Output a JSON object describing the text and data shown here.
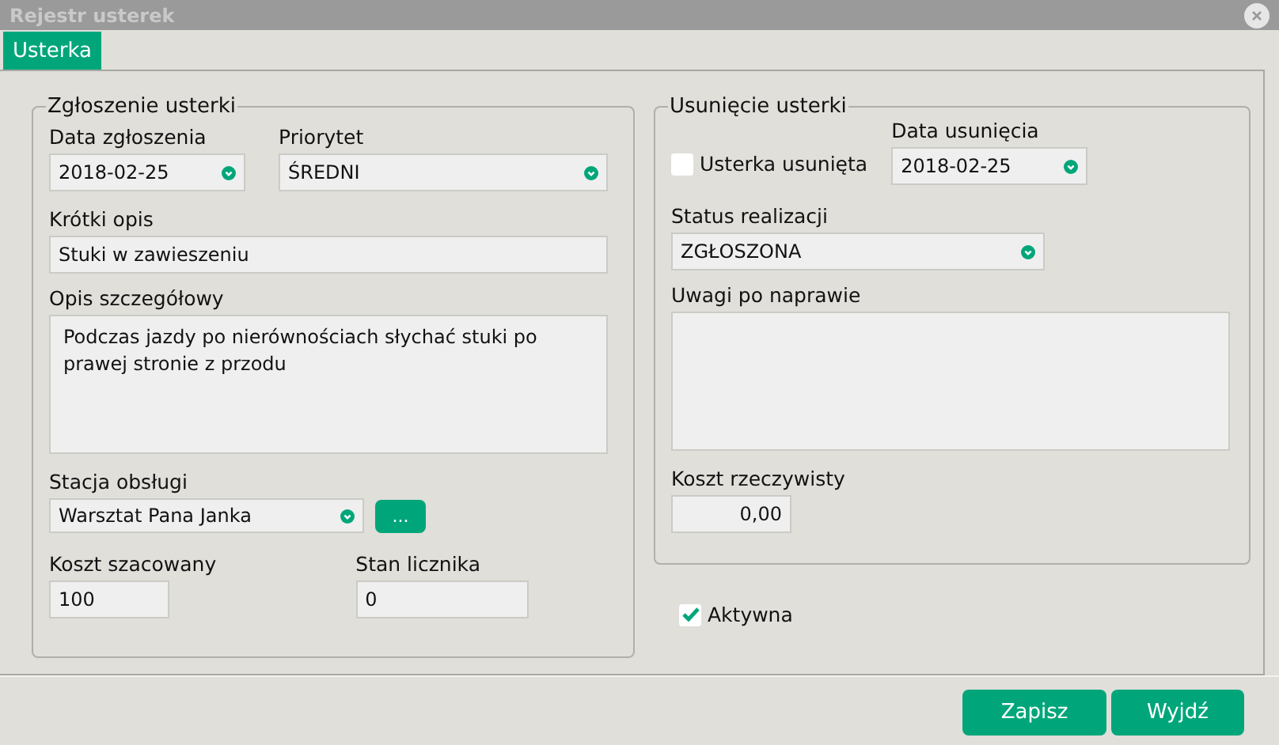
{
  "window": {
    "title": "Rejestr usterek"
  },
  "tabs": [
    {
      "label": "Usterka",
      "selected": true
    }
  ],
  "report": {
    "legend": "Zgłoszenie usterki",
    "date": {
      "label": "Data zgłoszenia",
      "value": "2018-02-25"
    },
    "priority": {
      "label": "Priorytet",
      "value": "ŚREDNI"
    },
    "short_description": {
      "label": "Krótki opis",
      "value": "Stuki w zawieszeniu"
    },
    "details": {
      "label": "Opis szczegółowy",
      "value": "Podczas jazdy po nierównościach słychać stuki po prawej stronie z przodu"
    },
    "station": {
      "label": "Stacja obsługi",
      "value": "Warsztat Pana Janka",
      "button": "..."
    },
    "estimated_cost": {
      "label": "Koszt szacowany",
      "value": "100"
    },
    "odometer": {
      "label": "Stan licznika",
      "value": "0"
    }
  },
  "removal": {
    "legend": "Usunięcie usterki",
    "removed": {
      "label": "Usterka usunięta",
      "checked": false
    },
    "removal_date": {
      "label": "Data usunięcia",
      "value": "2018-02-25"
    },
    "status": {
      "label": "Status realizacji",
      "value": "ZGŁOSZONA"
    },
    "notes": {
      "label": "Uwagi po naprawie"
    },
    "actual_cost": {
      "label": "Koszt rzeczywisty",
      "value": "0,00"
    }
  },
  "active": {
    "label": "Aktywna",
    "checked": true
  },
  "buttons": [
    "Zapisz",
    "Wyjdź"
  ]
}
